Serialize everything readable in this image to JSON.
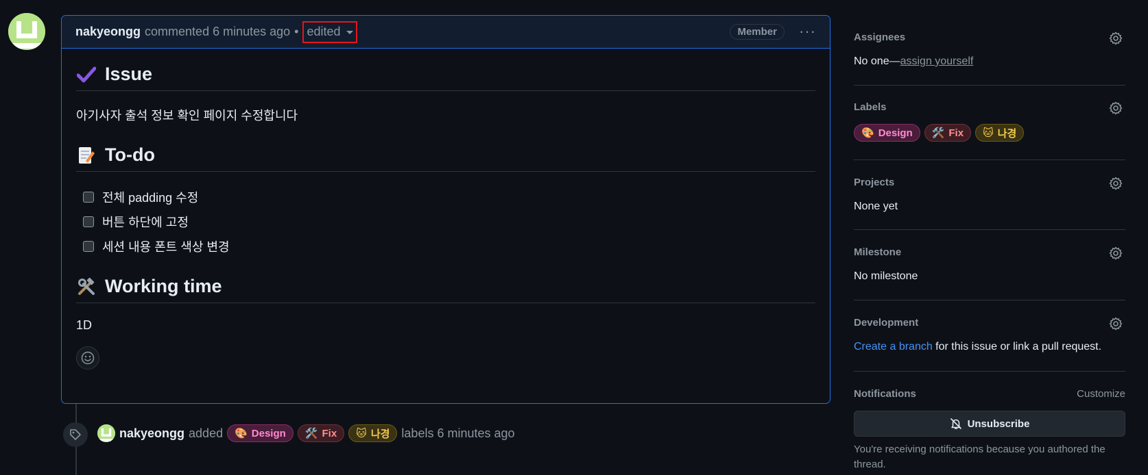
{
  "comment": {
    "author": "nakyeongg",
    "action": "commented 6 minutes ago",
    "separator": "•",
    "edited_label": "edited",
    "role_badge": "Member",
    "more_label": "···",
    "body": {
      "h_issue": "Issue",
      "issue_text": "아기사자 출석 정보 확인 페이지 수정합니다",
      "h_todo": "To-do",
      "tasks": [
        "전체 padding 수정",
        "버튼 하단에 고정",
        "세션 내용 폰트 색상 변경"
      ],
      "h_working": "Working time",
      "working_text": "1D"
    }
  },
  "timeline": {
    "author": "nakyeongg",
    "added": "added",
    "labels_suffix": "labels 6 minutes ago"
  },
  "labels": [
    {
      "name": "Design",
      "emoji": "🎨"
    },
    {
      "name": "Fix",
      "emoji": "🛠️"
    },
    {
      "name": "나경",
      "emoji": "🐱"
    }
  ],
  "sidebar": {
    "assignees": {
      "title": "Assignees",
      "value": "No one—",
      "assign_link": "assign yourself"
    },
    "labels": {
      "title": "Labels"
    },
    "projects": {
      "title": "Projects",
      "value": "None yet"
    },
    "milestone": {
      "title": "Milestone",
      "value": "No milestone"
    },
    "development": {
      "title": "Development",
      "link": "Create a branch",
      "rest": " for this issue or link a pull request."
    },
    "notifications": {
      "title": "Notifications",
      "customize": "Customize",
      "unsubscribe": "Unsubscribe",
      "note": "You're receiving notifications because you authored the thread."
    }
  },
  "colors": {
    "accent": "#1f6feb",
    "link": "#4493f8",
    "avatar": "#b6e388",
    "highlight": "#e5161a"
  }
}
